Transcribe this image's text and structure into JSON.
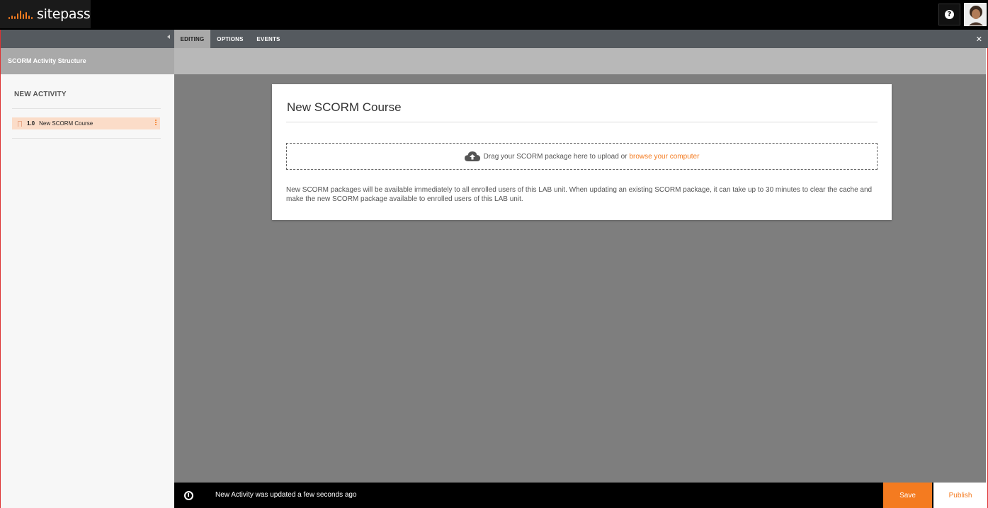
{
  "app": {
    "logo_text": "sitepass",
    "help_icon": "help-icon",
    "accent_color": "#f47b20"
  },
  "sidebar": {
    "header": "SCORM Activity Structure",
    "activity_title": "NEW ACTIVITY",
    "items": [
      {
        "number": "1.0",
        "label": "New SCORM Course"
      }
    ]
  },
  "tabs": [
    {
      "label": "EDITING",
      "active": true
    },
    {
      "label": "OPTIONS",
      "active": false
    },
    {
      "label": "EVENTS",
      "active": false
    }
  ],
  "card": {
    "title": "New SCORM Course",
    "drop_text": "Drag your SCORM package here to upload or",
    "browse_link": "browse your computer",
    "note": "New SCORM packages will be available immediately to all enrolled users of this LAB unit. When updating an existing SCORM package, it can take up to 30 minutes to clear the cache and make the new SCORM package available to enrolled users of this LAB unit."
  },
  "status": {
    "message": "New Activity was updated a few seconds ago"
  },
  "actions": {
    "save_label": "Save",
    "publish_label": "Publish"
  }
}
